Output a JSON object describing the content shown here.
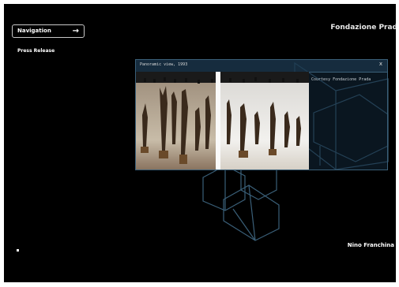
{
  "nav": {
    "label": "Navigation",
    "arrow": "→"
  },
  "brand": {
    "title": "Fondazione Prad"
  },
  "sidebar": {
    "press_release": "Press Release"
  },
  "panel": {
    "title": "Panoramic view, 1993",
    "close": "x",
    "credit": "Courtesy Fondazione Prada"
  },
  "artist": {
    "name": "Nino Franchina"
  },
  "colors": {
    "background": "#000000",
    "panel_border": "#3a5f78",
    "wireframe": "#3a5f78",
    "text": "#ffffff"
  }
}
